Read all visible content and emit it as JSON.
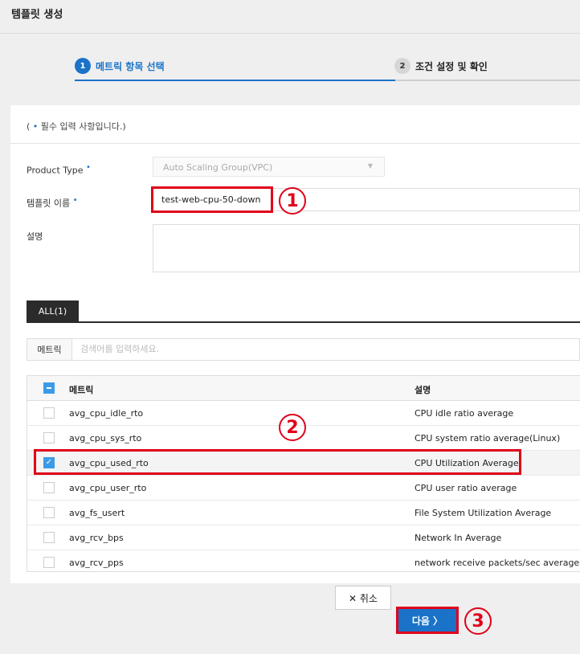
{
  "page": {
    "title": "템플릿 생성"
  },
  "stepper": {
    "step1": {
      "num": "1",
      "label": "메트릭 항목 선택"
    },
    "step2": {
      "num": "2",
      "label": "조건 설정 및 확인"
    }
  },
  "form": {
    "required_note_prefix": "(",
    "required_note_dot": "•",
    "required_note_text": " 필수 입력 사항입니다.)",
    "product_type_label": "Product Type",
    "product_type_value": "Auto Scaling Group(VPC)",
    "template_name_label": "템플릿 이름",
    "template_name_value": "test-web-cpu-50-down",
    "description_label": "설명",
    "required_dot": "•"
  },
  "tabs": {
    "all": "ALL(1)"
  },
  "search": {
    "label": "메트릭",
    "placeholder": "검색어를 입력하세요."
  },
  "table": {
    "headers": {
      "metric": "메트릭",
      "description": "설명"
    },
    "rows": [
      {
        "metric": "avg_cpu_idle_rto",
        "description": "CPU idle ratio average",
        "checked": false
      },
      {
        "metric": "avg_cpu_sys_rto",
        "description": "CPU system ratio average(Linux)",
        "checked": false
      },
      {
        "metric": "avg_cpu_used_rto",
        "description": "CPU Utilization Average",
        "checked": true
      },
      {
        "metric": "avg_cpu_user_rto",
        "description": "CPU user ratio average",
        "checked": false
      },
      {
        "metric": "avg_fs_usert",
        "description": "File System Utilization Average",
        "checked": false
      },
      {
        "metric": "avg_rcv_bps",
        "description": "Network In Average",
        "checked": false
      },
      {
        "metric": "avg_rcv_pps",
        "description": "network receive packets/sec average",
        "checked": false
      }
    ]
  },
  "buttons": {
    "cancel": "✕ 취소",
    "next": "다음 〉"
  },
  "annotations": {
    "one": "1",
    "two": "2",
    "three": "3"
  },
  "colors": {
    "accent": "#1a73c8",
    "highlight": "#e0001a"
  }
}
